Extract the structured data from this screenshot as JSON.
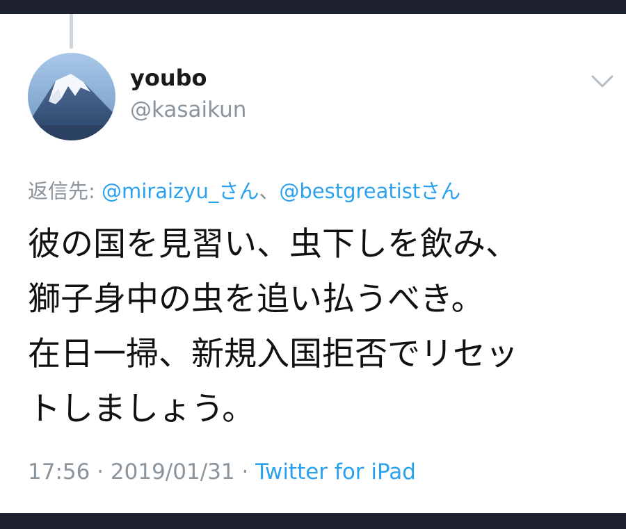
{
  "tweet": {
    "author": {
      "display_name": "youbo",
      "handle": "@kasaikun"
    },
    "reply_to": {
      "prefix": "返信先: ",
      "mentions": [
        {
          "text": "@miraizyu_さん"
        },
        {
          "text": "@bestgreatistさん"
        }
      ],
      "separator": "、"
    },
    "body_lines": [
      "彼の国を見習い、虫下しを飲み、",
      "獅子身中の虫を追い払うべき。",
      "在日一掃、新規入国拒否でリセッ",
      "トしましょう。"
    ],
    "meta": {
      "time": "17:56",
      "dot1": " · ",
      "date": "2019/01/31",
      "dot2": " · ",
      "source": "Twitter for iPad"
    }
  },
  "icons": {
    "menu": "chevron-down-icon",
    "avatar": "mountain-avatar"
  },
  "colors": {
    "chrome_bar": "#1e2230",
    "link": "#2aa1ef",
    "secondary_text": "#8a949c",
    "primary_text": "#111111"
  }
}
